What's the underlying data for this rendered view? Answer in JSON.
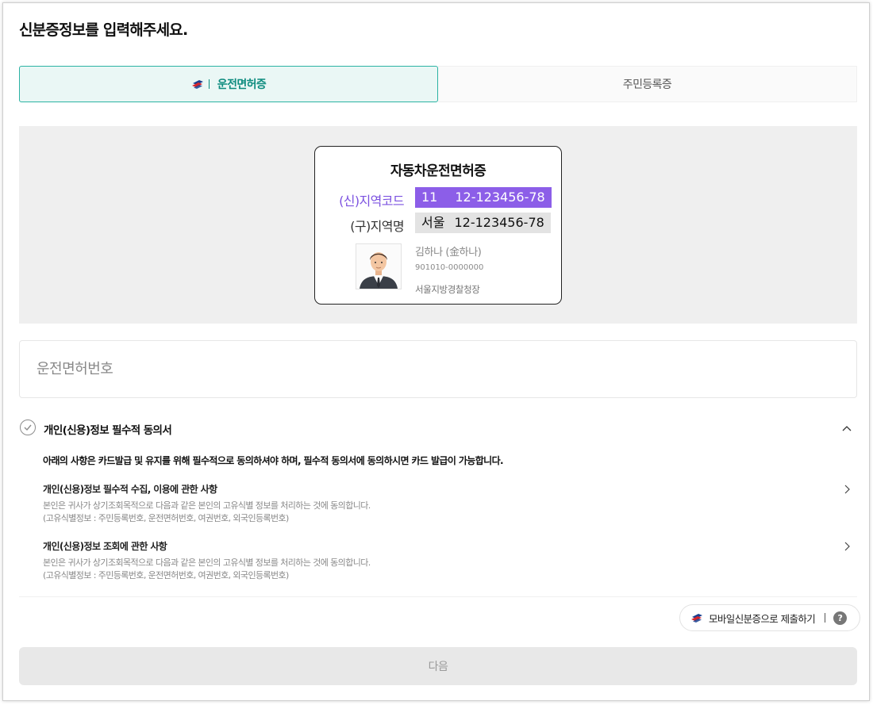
{
  "page": {
    "title": "신분증정보를 입력해주세요."
  },
  "tabs": [
    {
      "label": "운전면허증",
      "active": true
    },
    {
      "label": "주민등록증",
      "active": false
    }
  ],
  "license_card": {
    "title": "자동차운전면허증",
    "new_region": {
      "label": "(신)지역코드",
      "code": "11",
      "number": "12-123456-78"
    },
    "old_region": {
      "label": "(구)지역명",
      "code": "서울",
      "number": "12-123456-78"
    },
    "holder_name": "김하나 (金하나)",
    "holder_id": "901010-0000000",
    "issuer": "서울지방경찰청장"
  },
  "license_input": {
    "placeholder": "운전면허번호",
    "value": ""
  },
  "agreement": {
    "title": "개인(신용)정보 필수적 동의서",
    "notice": "아래의 사항은 카드발급 및 유지를 위해 필수적으로 동의하셔야 하며, 필수적 동의서에 동의하시면 카드 발급이 가능합니다.",
    "items": [
      {
        "title": "개인(신용)정보 필수적 수집, 이용에 관한 사항",
        "desc_line1": "본인은 귀사가 상기조회목적으로 다음과 같은 본인의 고유식별 정보를 처리하는 것에 동의합니다.",
        "desc_line2": "(고유식별정보 : 주민등록번호, 운전면허번호, 여권번호, 외국인등록번호)"
      },
      {
        "title": "개인(신용)정보 조회에 관한 사항",
        "desc_line1": "본인은 귀사가 상기조회목적으로 다음과 같은 본인의 고유식별 정보를 처리하는 것에 동의합니다.",
        "desc_line2": "(고유식별정보 : 주민등록번호, 운전면허번호, 여권번호, 외국인등록번호)"
      }
    ]
  },
  "mobile_id": {
    "label": "모바일신분증으로 제출하기",
    "help": "?"
  },
  "next_button": {
    "label": "다음"
  },
  "colors": {
    "accent": "#2bb3a3",
    "accent_text": "#0e8c7f",
    "purple": "#8c5ee8",
    "disabled": "#e8e8e8"
  }
}
